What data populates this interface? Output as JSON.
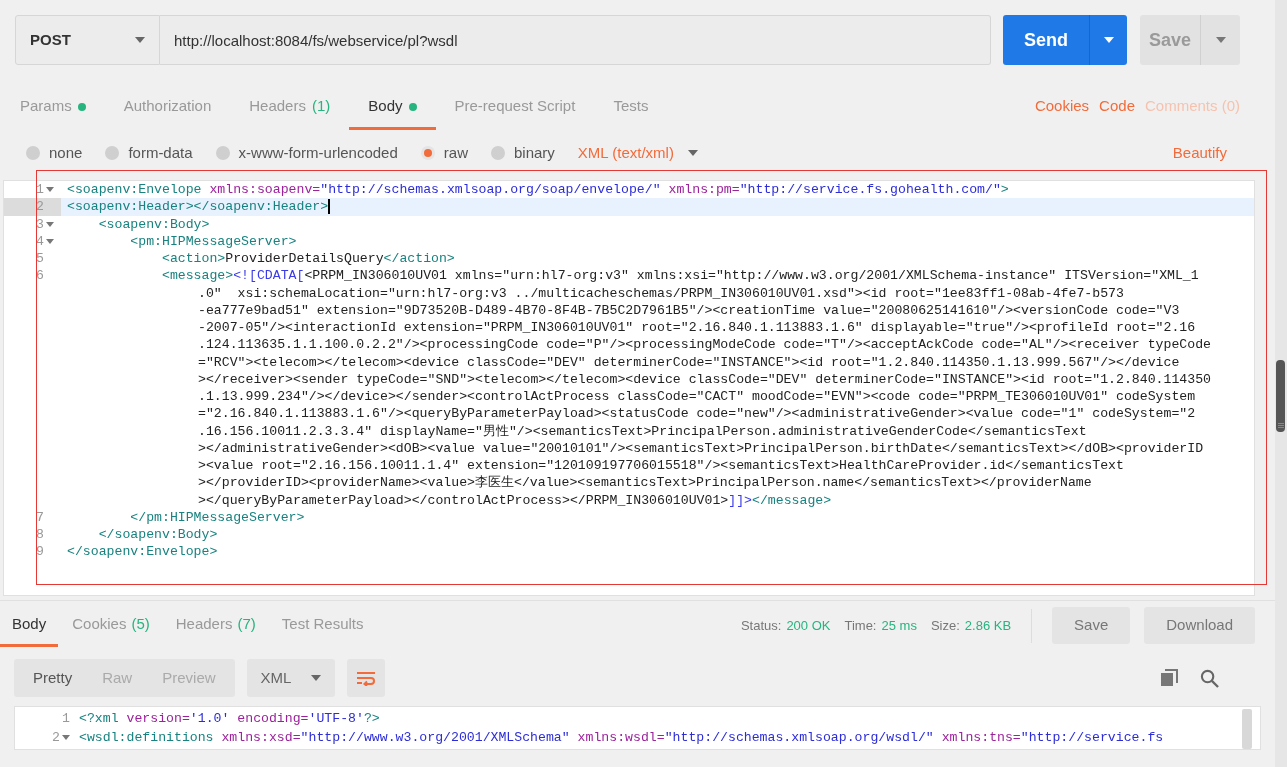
{
  "request": {
    "method": "POST",
    "url": "http://localhost:8084/fs/webservice/pl?wsdl",
    "send": "Send",
    "save": "Save"
  },
  "request_tabs": [
    {
      "label": "Params",
      "dot": true,
      "selected": false
    },
    {
      "label": "Authorization",
      "dot": false,
      "selected": false
    },
    {
      "label": "Headers",
      "count": "(1)",
      "dot": false,
      "selected": false
    },
    {
      "label": "Body",
      "dot": true,
      "selected": true
    },
    {
      "label": "Pre-request Script",
      "dot": false,
      "selected": false
    },
    {
      "label": "Tests",
      "dot": false,
      "selected": false
    }
  ],
  "request_links": [
    {
      "label": "Cookies",
      "disabled": false
    },
    {
      "label": "Code",
      "disabled": false
    },
    {
      "label": "Comments (0)",
      "disabled": true
    }
  ],
  "body_types": [
    {
      "label": "none",
      "selected": false
    },
    {
      "label": "form-data",
      "selected": false
    },
    {
      "label": "x-www-form-urlencoded",
      "selected": false
    },
    {
      "label": "raw",
      "selected": true
    },
    {
      "label": "binary",
      "selected": false
    }
  ],
  "content_type": "XML (text/xml)",
  "beautify": "Beautify",
  "editor": {
    "rows": [
      {
        "kind": "line",
        "number": "1",
        "foldable": true,
        "active": false,
        "segments": [
          {
            "kind": "tag",
            "text": "<soapenv:Envelope"
          },
          {
            "kind": "attr",
            "text": " xmlns:soapenv="
          },
          {
            "kind": "value",
            "text": "\"http://schemas.xmlsoap.org/soap/envelope/\""
          },
          {
            "kind": "attr",
            "text": " xmlns:pm="
          },
          {
            "kind": "value",
            "text": "\"http://service.fs.gohealth.com/\""
          },
          {
            "kind": "tag",
            "text": ">"
          }
        ]
      },
      {
        "kind": "line",
        "number": "2",
        "foldable": false,
        "active": true,
        "segments": [
          {
            "kind": "tag",
            "text": "<soapenv:Header></soapenv:Header>"
          }
        ]
      },
      {
        "kind": "line",
        "number": "3",
        "foldable": true,
        "active": false,
        "segments": [
          {
            "kind": "tag",
            "text": "    <soapenv:Body>"
          }
        ]
      },
      {
        "kind": "line",
        "number": "4",
        "foldable": true,
        "active": false,
        "segments": [
          {
            "kind": "tag",
            "text": "        <pm:HIPMessageServer>"
          }
        ]
      },
      {
        "kind": "line",
        "number": "5",
        "foldable": false,
        "active": false,
        "segments": [
          {
            "kind": "tag",
            "text": "            <action>"
          },
          {
            "kind": "text",
            "text": "ProviderDetailsQuery"
          },
          {
            "kind": "tag",
            "text": "</action>"
          }
        ]
      },
      {
        "kind": "line",
        "number": "6",
        "foldable": false,
        "active": false,
        "segments": [
          {
            "kind": "tag",
            "text": "            <message>"
          },
          {
            "kind": "cdata",
            "text": "<![CDATA["
          },
          {
            "kind": "text",
            "text": "<PRPM_IN306010UV01 xmlns=\"urn:hl7-org:v3\" xmlns:xsi=\"http://www.w3.org/2001/XMLSchema-instance\" ITSVersion=\"XML_1"
          }
        ]
      },
      {
        "kind": "wrap",
        "segments": [
          {
            "kind": "text",
            "text": ".0\"  xsi:schemaLocation=\"urn:hl7-org:v3 ../multicacheschemas/PRPM_IN306010UV01.xsd\"><id root=\"1ee83ff1-08ab-4fe7-b573"
          }
        ]
      },
      {
        "kind": "wrap",
        "segments": [
          {
            "kind": "text",
            "text": "-ea777e9bad51\" extension=\"9D73520B-D489-4B70-8F4B-7B5C2D7961B5\"/><creationTime value=\"20080625141610\"/><versionCode code=\"V3"
          }
        ]
      },
      {
        "kind": "wrap",
        "segments": [
          {
            "kind": "text",
            "text": "-2007-05\"/><interactionId extension=\"PRPM_IN306010UV01\" root=\"2.16.840.1.113883.1.6\" displayable=\"true\"/><profileId root=\"2.16"
          }
        ]
      },
      {
        "kind": "wrap",
        "segments": [
          {
            "kind": "text",
            "text": ".124.113635.1.1.100.0.2.2\"/><processingCode code=\"P\"/><processingModeCode code=\"T\"/><acceptAckCode code=\"AL\"/><receiver typeCode"
          }
        ]
      },
      {
        "kind": "wrap",
        "segments": [
          {
            "kind": "text",
            "text": "=\"RCV\"><telecom></telecom><device classCode=\"DEV\" determinerCode=\"INSTANCE\"><id root=\"1.2.840.114350.1.13.999.567\"/></device"
          }
        ]
      },
      {
        "kind": "wrap",
        "segments": [
          {
            "kind": "text",
            "text": "></receiver><sender typeCode=\"SND\"><telecom></telecom><device classCode=\"DEV\" determinerCode=\"INSTANCE\"><id root=\"1.2.840.114350"
          }
        ]
      },
      {
        "kind": "wrap",
        "segments": [
          {
            "kind": "text",
            "text": ".1.13.999.234\"/></device></sender><controlActProcess classCode=\"CACT\" moodCode=\"EVN\"><code code=\"PRPM_TE306010UV01\" codeSystem"
          }
        ]
      },
      {
        "kind": "wrap",
        "segments": [
          {
            "kind": "text",
            "text": "=\"2.16.840.1.113883.1.6\"/><queryByParameterPayload><statusCode code=\"new\"/><administrativeGender><value code=\"1\" codeSystem=\"2"
          }
        ]
      },
      {
        "kind": "wrap",
        "segments": [
          {
            "kind": "text",
            "text": ".16.156.10011.2.3.3.4\" displayName=\"男性\"/><semanticsText>PrincipalPerson.administrativeGenderCode</semanticsText"
          }
        ]
      },
      {
        "kind": "wrap",
        "segments": [
          {
            "kind": "text",
            "text": "></administrativeGender><dOB><value value=\"20010101\"/><semanticsText>PrincipalPerson.birthDate</semanticsText></dOB><providerID"
          }
        ]
      },
      {
        "kind": "wrap",
        "segments": [
          {
            "kind": "text",
            "text": "><value root=\"2.16.156.10011.1.4\" extension=\"120109197706015518\"/><semanticsText>HealthCareProvider.id</semanticsText"
          }
        ]
      },
      {
        "kind": "wrap",
        "segments": [
          {
            "kind": "text",
            "text": "></providerID><providerName><value>李医生</value><semanticsText>PrincipalPerson.name</semanticsText></providerName"
          }
        ]
      },
      {
        "kind": "wrap",
        "segments": [
          {
            "kind": "text",
            "text": "></queryByParameterPayload></controlActProcess></PRPM_IN306010UV01>"
          },
          {
            "kind": "cdata",
            "text": "]]>"
          },
          {
            "kind": "tag",
            "text": "</message>"
          }
        ]
      },
      {
        "kind": "line",
        "number": "7",
        "foldable": false,
        "active": false,
        "segments": [
          {
            "kind": "tag",
            "text": "        </pm:HIPMessageServer>"
          }
        ]
      },
      {
        "kind": "line",
        "number": "8",
        "foldable": false,
        "active": false,
        "segments": [
          {
            "kind": "tag",
            "text": "    </soapenv:Body>"
          }
        ]
      },
      {
        "kind": "line",
        "number": "9",
        "foldable": false,
        "active": false,
        "segments": [
          {
            "kind": "tag",
            "text": "</soapenv:Envelope>"
          }
        ]
      }
    ]
  },
  "response_tabs": [
    {
      "label": "Body",
      "selected": true
    },
    {
      "label": "Cookies",
      "count": "(5)",
      "selected": false
    },
    {
      "label": "Headers",
      "count": "(7)",
      "selected": false
    },
    {
      "label": "Test Results",
      "selected": false
    }
  ],
  "response_stats": [
    {
      "label": "Status:",
      "value": "200 OK"
    },
    {
      "label": "Time:",
      "value": "25 ms"
    },
    {
      "label": "Size:",
      "value": "2.86 KB"
    }
  ],
  "response_buttons": [
    "Save",
    "Download"
  ],
  "view_modes": [
    {
      "label": "Pretty",
      "selected": true
    },
    {
      "label": "Raw",
      "selected": false
    },
    {
      "label": "Preview",
      "selected": false
    }
  ],
  "response_format": "XML",
  "response_editor": {
    "rows": [
      {
        "kind": "line",
        "number": "1",
        "foldable": false,
        "active": false,
        "segments": [
          {
            "kind": "tag",
            "text": "<?xml"
          },
          {
            "kind": "attr",
            "text": " version="
          },
          {
            "kind": "value",
            "text": "'1.0'"
          },
          {
            "kind": "attr",
            "text": " encoding="
          },
          {
            "kind": "value",
            "text": "'UTF-8'"
          },
          {
            "kind": "tag",
            "text": "?>"
          }
        ]
      },
      {
        "kind": "line",
        "number": "2",
        "foldable": true,
        "active": false,
        "segments": [
          {
            "kind": "tag",
            "text": "<wsdl:definitions"
          },
          {
            "kind": "attr",
            "text": " xmlns:xsd="
          },
          {
            "kind": "value",
            "text": "\"http://www.w3.org/2001/XMLSchema\""
          },
          {
            "kind": "attr",
            "text": " xmlns:wsdl="
          },
          {
            "kind": "value",
            "text": "\"http://schemas.xmlsoap.org/wsdl/\""
          },
          {
            "kind": "attr",
            "text": " xmlns:tns="
          },
          {
            "kind": "value",
            "text": "\"http://service.fs"
          }
        ]
      }
    ]
  }
}
